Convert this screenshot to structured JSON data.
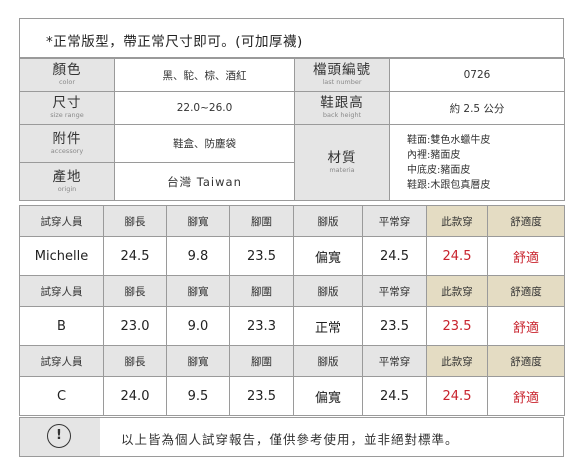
{
  "note": "*正常版型，帶正常尺寸即可。(可加厚襪)",
  "spec": {
    "color_label": "顏色",
    "color_label_en": "color",
    "color_value": "黑、駝、棕、酒紅",
    "item_label": "檔頭編號",
    "item_label_en": "last number",
    "item_value": "0726",
    "size_label": "尺寸",
    "size_label_en": "size range",
    "size_value": "22.0~26.0",
    "heel_label": "鞋跟高",
    "heel_label_en": "back height",
    "heel_value": "約 2.5 公分",
    "acc_label": "附件",
    "acc_label_en": "accessory",
    "acc_value": "鞋盒、防塵袋",
    "material_label": "材質",
    "material_label_en": "materia",
    "material_lines": [
      "鞋面:雙色水蠟牛皮",
      "內裡:豬面皮",
      "中底皮:豬面皮",
      "鞋跟:木跟包真層皮"
    ],
    "origin_label": "產地",
    "origin_label_en": "origin",
    "origin_value": "台灣 Taiwan"
  },
  "fit_headers": [
    "試穿人員",
    "腳長",
    "腳寬",
    "腳圍",
    "腳版",
    "平常穿",
    "此款穿",
    "舒適度"
  ],
  "fit_rows": [
    [
      "Michelle",
      "24.5",
      "9.8",
      "23.5",
      "偏寬",
      "24.5",
      "24.5",
      "舒適"
    ],
    [
      "B",
      "23.0",
      "9.0",
      "23.3",
      "正常",
      "23.5",
      "23.5",
      "舒適"
    ],
    [
      "C",
      "24.0",
      "9.5",
      "23.5",
      "偏寬",
      "24.5",
      "24.5",
      "舒適"
    ]
  ],
  "notice": {
    "icon": "exclamation-circle-icon",
    "icon_glyph": "!",
    "text": "以上皆為個人試穿報告，僅供參考使用，並非絕對標準。"
  }
}
